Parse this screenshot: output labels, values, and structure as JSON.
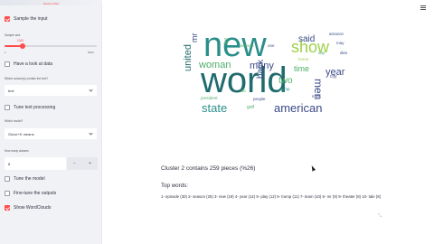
{
  "sidebar": {
    "top_link": "Session Plan",
    "sample_input": {
      "label": "Sample the input",
      "checked": true
    },
    "sample_size": {
      "label": "Sample size",
      "value": 1000,
      "min": 1,
      "max": 5000,
      "min_label": "1",
      "max_label": "5000"
    },
    "look_at_data": {
      "label": "Have a look at data",
      "checked": false
    },
    "text_column": {
      "label": "Which column(s) contain the text?",
      "value": "text"
    },
    "tune_text": {
      "label": "Tune text processing",
      "checked": false
    },
    "model": {
      "label": "Which model?",
      "value": "Glove+K means"
    },
    "n_clusters": {
      "label": "How many classes",
      "value": "8",
      "minus": "−",
      "plus": "+"
    },
    "tune_model": {
      "label": "Tune the model",
      "checked": false
    },
    "fine_tune": {
      "label": "Fine-tune the outputs",
      "checked": false
    },
    "show_wordclouds": {
      "label": "Show WordClouds",
      "checked": true
    }
  },
  "main": {
    "menu_icon": "hamburger-menu-icon",
    "cluster_text": "Cluster 2 contains 259 pieces (%26)",
    "top_words_heading": "Top words:",
    "top_words": "1- episode (30) 2- season (25) 3- new (19) 4- year (14) 5- play (12) 6- trump (11) 7- team (10) 8- mr (9) 9- theater (8) 10- tale (8)",
    "wordcloud": {
      "colors": {
        "dark": "#1f6b6e",
        "teal": "#2a8f8a",
        "green": "#4fae6a",
        "lime": "#9fd04a",
        "navy": "#3b4a86",
        "purple": "#4a2a6b"
      },
      "words": [
        {
          "text": "new",
          "color": "teal"
        },
        {
          "text": "world",
          "color": "dark"
        },
        {
          "text": "show",
          "color": "lime"
        },
        {
          "text": "woman",
          "color": "green"
        },
        {
          "text": "said",
          "color": "navy"
        },
        {
          "text": "american",
          "color": "navy"
        },
        {
          "text": "state",
          "color": "teal"
        },
        {
          "text": "united",
          "color": "dark"
        },
        {
          "text": "many",
          "color": "navy"
        },
        {
          "text": "men",
          "color": "navy"
        },
        {
          "text": "year",
          "color": "navy"
        },
        {
          "text": "time",
          "color": "green"
        },
        {
          "text": "back",
          "color": "navy"
        },
        {
          "text": "two",
          "color": "green"
        },
        {
          "text": "mr",
          "color": "navy"
        },
        {
          "text": "amazon",
          "color": "navy"
        },
        {
          "text": "golf",
          "color": "green"
        },
        {
          "text": "may",
          "color": "navy"
        },
        {
          "text": "city",
          "color": "navy"
        },
        {
          "text": "people",
          "color": "navy"
        },
        {
          "text": "president",
          "color": "green"
        },
        {
          "text": "first",
          "color": "green"
        },
        {
          "text": "home",
          "color": "lime"
        },
        {
          "text": "season",
          "color": "green"
        },
        {
          "text": "trump",
          "color": "teal"
        },
        {
          "text": "dies",
          "color": "navy"
        },
        {
          "text": "life",
          "color": "green"
        },
        {
          "text": "one",
          "color": "navy"
        },
        {
          "text": "right",
          "color": "navy"
        },
        {
          "text": "day",
          "color": "green"
        }
      ]
    }
  }
}
